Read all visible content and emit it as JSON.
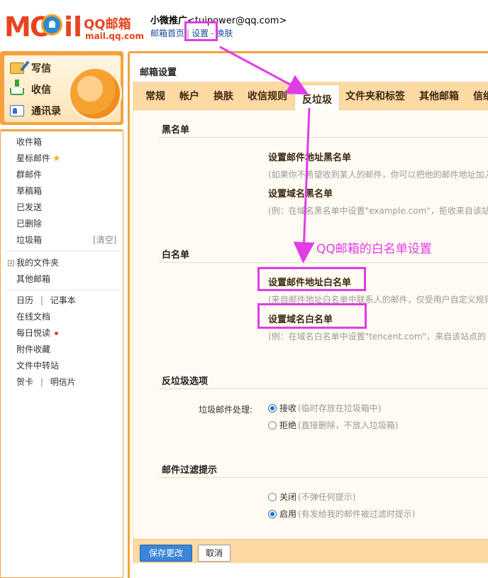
{
  "logo": {
    "part1": "MO",
    "part2": "il",
    "brand_cn": "QQ邮箱",
    "brand_url": "mail.qq.com"
  },
  "header": {
    "user_name": "小微推广",
    "user_email": "<tuipower@qq.com>",
    "links": [
      "邮箱首页",
      "设置",
      "换肤"
    ]
  },
  "left_actions": [
    "写信",
    "收信",
    "通讯录"
  ],
  "sidebar": {
    "folders": [
      "收件箱",
      "星标邮件",
      "群邮件",
      "草稿箱",
      "已发送",
      "已删除",
      "垃圾箱"
    ],
    "clear_label": "[清空]",
    "my_folders": "我的文件夹",
    "other_mail": "其他邮箱",
    "calendar": "日历",
    "notebook": "记事本",
    "online_docs": "在线文档",
    "daily_read": "每日悦读",
    "attachments": "附件收藏",
    "transfer": "文件中转站",
    "greeting_card": "贺卡",
    "postcard": "明信片",
    "separator": "|"
  },
  "main": {
    "title": "邮箱设置",
    "tabs": [
      "常规",
      "帐户",
      "换肤",
      "收信规则",
      "反垃圾",
      "文件夹和标签",
      "其他邮箱",
      "信纸"
    ],
    "active_tab": "反垃圾",
    "blacklist": {
      "heading": "黑名单",
      "addr_link": "设置邮件地址黑名单",
      "addr_desc": "(如果你不希望收到某人的邮件，你可以把他的邮件地址加入",
      "domain_link": "设置域名黑名单",
      "domain_desc": "(例：在域名黑名单中设置\"example.com\"，拒收来自该站"
    },
    "whitelist": {
      "heading": "白名单",
      "addr_link": "设置邮件地址白名单",
      "addr_desc": "(来自邮件地址白名单中联系人的邮件，仅受用户自定义规则",
      "domain_link": "设置域名白名单",
      "domain_desc": "(例：在域名白名单中设置\"tencent.com\"，来自该站点的"
    },
    "antispam": {
      "heading": "反垃圾选项",
      "label": "垃圾邮件处理:",
      "opt1": "接收",
      "opt1_hint": "(临时存放在垃圾箱中)",
      "opt2": "拒绝",
      "opt2_hint": "(直接删除，不放入垃圾箱)"
    },
    "filter": {
      "heading": "邮件过滤提示",
      "opt1": "关闭",
      "opt1_hint": "(不弹任何提示)",
      "opt2": "启用",
      "opt2_hint": "(有发给我的邮件被过滤时提示)"
    },
    "save_label": "保存更改",
    "cancel_label": "取消"
  },
  "annotation": {
    "text": "QQ邮箱的白名单设置",
    "color": "#e03ce8"
  },
  "colors": {
    "accent_orange": "#f5a23e",
    "tab_bg": "#fdd9a4",
    "primary_button": "#3a86d8",
    "brand_red": "#e8431f"
  }
}
